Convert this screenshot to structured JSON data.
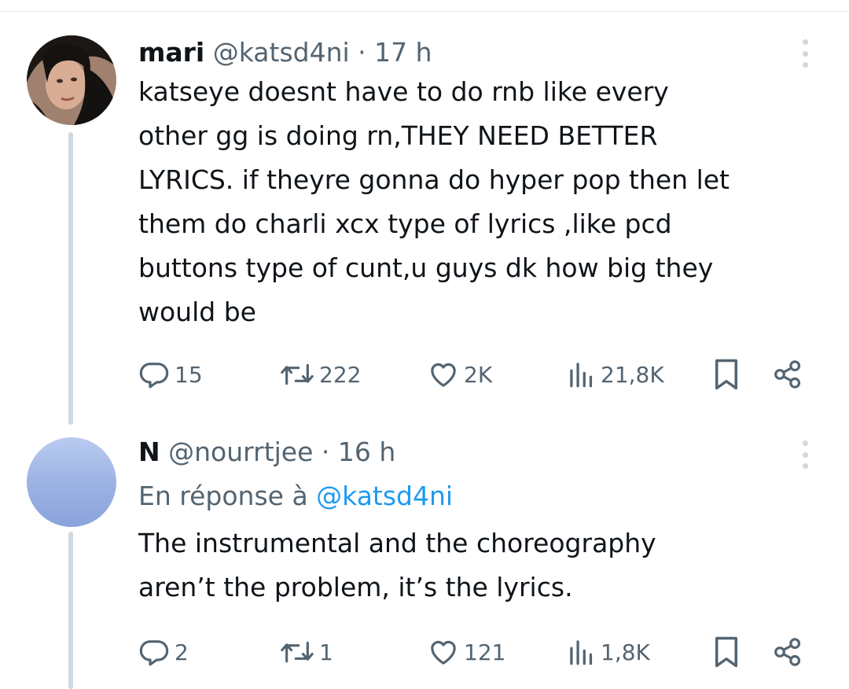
{
  "tweets": [
    {
      "name": "mari",
      "handle": "@katsd4ni",
      "dot": "·",
      "time": "17 h",
      "text_lines": [
        "katseye doesnt have to do rnb like every",
        "other gg is doing rn,THEY NEED BETTER",
        "LYRICS. if theyre gonna do hyper pop then let",
        "them do charli xcx type of lyrics ,like pcd",
        "buttons type of cunt,u guys dk how big they",
        "would be"
      ],
      "actions": {
        "replies": "15",
        "retweets": "222",
        "likes": "2K",
        "views": "21,8K"
      },
      "icons": {
        "reply": "reply-icon",
        "retweet": "retweet-icon",
        "like": "heart-icon",
        "views": "views-icon",
        "bookmark": "bookmark-icon",
        "share": "share-icon",
        "more": "more-icon"
      }
    },
    {
      "name": "N",
      "handle": "@nourrtjee",
      "dot": "·",
      "time": "16 h",
      "reply_prefix": "En réponse à",
      "reply_mention": "@katsd4ni",
      "text_lines": [
        "The instrumental and the choreography",
        "aren’t the problem, it’s the lyrics."
      ],
      "actions": {
        "replies": "2",
        "retweets": "1",
        "likes": "121",
        "views": "1,8K"
      },
      "icons": {
        "reply": "reply-icon",
        "retweet": "retweet-icon",
        "like": "heart-icon",
        "views": "views-icon",
        "bookmark": "bookmark-icon",
        "share": "share-icon",
        "more": "more-icon"
      }
    }
  ],
  "colors": {
    "text": "#0f1419",
    "secondary": "#536471",
    "link": "#1d9bf0",
    "thread_line": "#cfd9de"
  }
}
